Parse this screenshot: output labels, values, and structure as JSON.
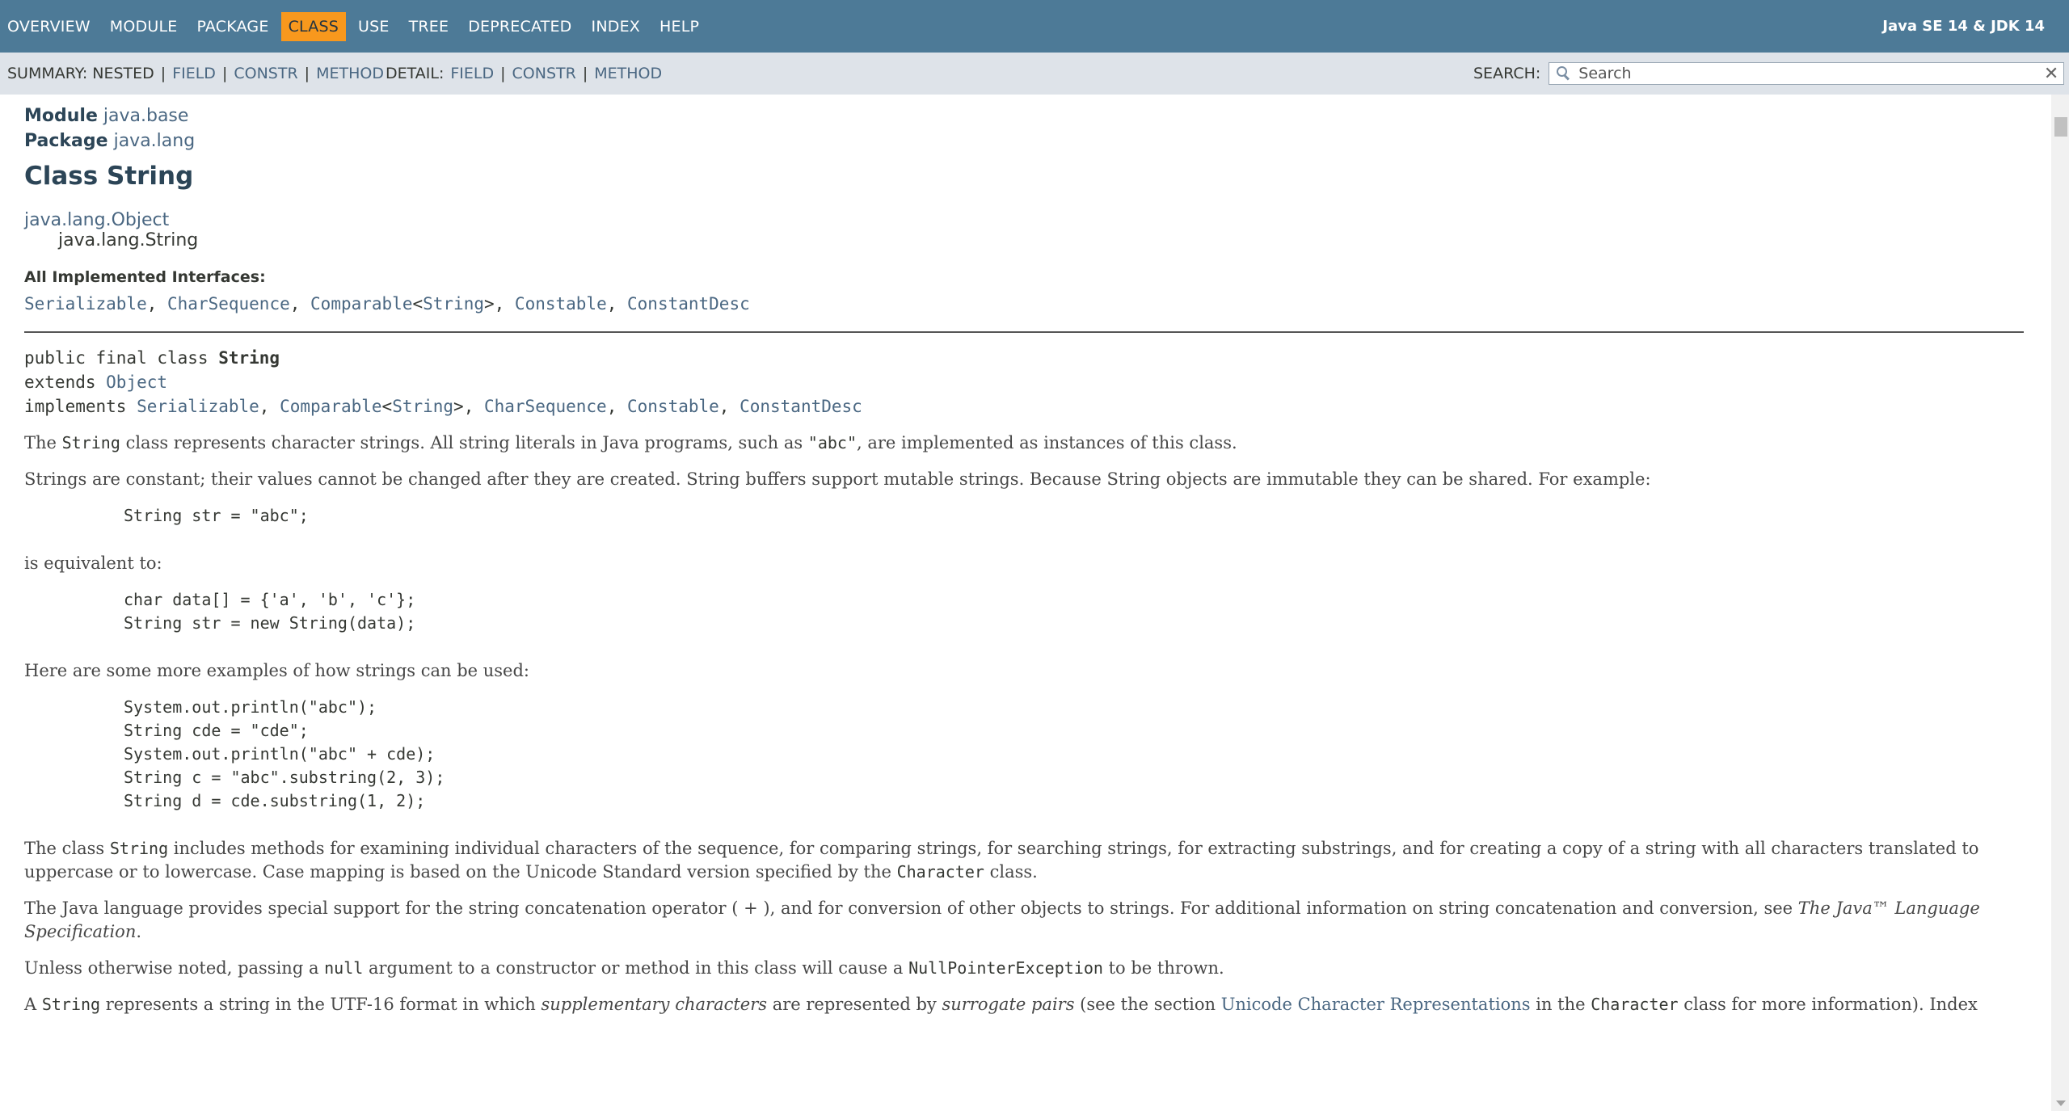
{
  "topnav": {
    "items": [
      "OVERVIEW",
      "MODULE",
      "PACKAGE",
      "CLASS",
      "USE",
      "TREE",
      "DEPRECATED",
      "INDEX",
      "HELP"
    ],
    "active": "CLASS",
    "about": "Java SE 14 & JDK 14"
  },
  "subnav": {
    "summary_label": "SUMMARY: NESTED",
    "summary_links": [
      "FIELD",
      "CONSTR",
      "METHOD"
    ],
    "detail_label": "DETAIL:",
    "detail_links": [
      "FIELD",
      "CONSTR",
      "METHOD"
    ],
    "search_label": "SEARCH:",
    "search_placeholder": "Search",
    "search_reset": "✕"
  },
  "header": {
    "module_label": "Module",
    "module_name": "java.base",
    "package_label": "Package",
    "package_name": "java.lang",
    "title": "Class String"
  },
  "inheritance": {
    "parent": "java.lang.Object",
    "child": "java.lang.String"
  },
  "interfaces": {
    "label": "All Implemented Interfaces:",
    "items": [
      "Serializable",
      "CharSequence",
      "Comparable",
      "String",
      "Constable",
      "ConstantDesc"
    ]
  },
  "signature": {
    "line1_prefix": "public final class ",
    "line1_name": "String",
    "extends_kw": "extends ",
    "extends_type": "Object",
    "implements_kw": "implements ",
    "implements": [
      "Serializable",
      "Comparable",
      "String",
      "CharSequence",
      "Constable",
      "ConstantDesc"
    ]
  },
  "description": {
    "p1_a": "The ",
    "p1_code": "String",
    "p1_b": " class represents character strings. All string literals in Java programs, such as ",
    "p1_code2": "\"abc\"",
    "p1_c": ", are implemented as instances of this class.",
    "p2": "Strings are constant; their values cannot be changed after they are created. String buffers support mutable strings. Because String objects are immutable they can be shared. For example:",
    "code1": "String str = \"abc\";",
    "p3": "is equivalent to:",
    "code2": "char data[] = {'a', 'b', 'c'};\nString str = new String(data);",
    "p4": "Here are some more examples of how strings can be used:",
    "code3": "System.out.println(\"abc\");\nString cde = \"cde\";\nSystem.out.println(\"abc\" + cde);\nString c = \"abc\".substring(2, 3);\nString d = cde.substring(1, 2);",
    "p5_a": "The class ",
    "p5_code": "String",
    "p5_b": " includes methods for examining individual characters of the sequence, for comparing strings, for searching strings, for extracting substrings, and for creating a copy of a string with all characters translated to uppercase or to lowercase. Case mapping is based on the Unicode Standard version specified by the ",
    "p5_link": "Character",
    "p5_c": " class.",
    "p6_a": "The Java language provides special support for the string concatenation operator ( + ), and for conversion of other objects to strings. For additional information on string concatenation and conversion, see ",
    "p6_em": "The Java™ Language Specification",
    "p6_b": ".",
    "p7_a": "Unless otherwise noted, passing a ",
    "p7_code": "null",
    "p7_b": " argument to a constructor or method in this class will cause a ",
    "p7_link": "NullPointerException",
    "p7_c": " to be thrown.",
    "p8_a": "A ",
    "p8_code": "String",
    "p8_b": " represents a string in the UTF-16 format in which ",
    "p8_em1": "supplementary characters",
    "p8_c": " are represented by ",
    "p8_em2": "surrogate pairs",
    "p8_d": " (see the section ",
    "p8_link": "Unicode Character Representations",
    "p8_e": " in the ",
    "p8_code2": "Character",
    "p8_f": " class for more information). Index"
  }
}
